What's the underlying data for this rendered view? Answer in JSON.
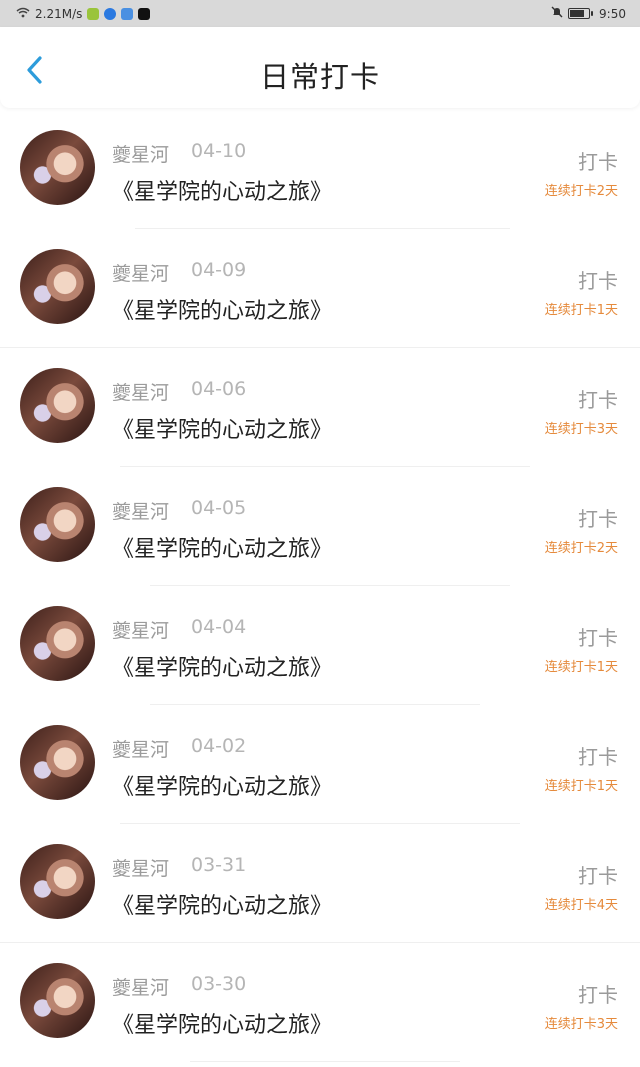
{
  "status_bar": {
    "speed": "2.21M/s",
    "time": "9:50"
  },
  "header": {
    "title": "日常打卡"
  },
  "items": [
    {
      "name": "夔星河",
      "date": "04-10",
      "book": "《星学院的心动之旅》",
      "action": "打卡",
      "streak": "连续打卡2天"
    },
    {
      "name": "夔星河",
      "date": "04-09",
      "book": "《星学院的心动之旅》",
      "action": "打卡",
      "streak": "连续打卡1天"
    },
    {
      "name": "夔星河",
      "date": "04-06",
      "book": "《星学院的心动之旅》",
      "action": "打卡",
      "streak": "连续打卡3天"
    },
    {
      "name": "夔星河",
      "date": "04-05",
      "book": "《星学院的心动之旅》",
      "action": "打卡",
      "streak": "连续打卡2天"
    },
    {
      "name": "夔星河",
      "date": "04-04",
      "book": "《星学院的心动之旅》",
      "action": "打卡",
      "streak": "连续打卡1天"
    },
    {
      "name": "夔星河",
      "date": "04-02",
      "book": "《星学院的心动之旅》",
      "action": "打卡",
      "streak": "连续打卡1天"
    },
    {
      "name": "夔星河",
      "date": "03-31",
      "book": "《星学院的心动之旅》",
      "action": "打卡",
      "streak": "连续打卡4天"
    },
    {
      "name": "夔星河",
      "date": "03-30",
      "book": "《星学院的心动之旅》",
      "action": "打卡",
      "streak": "连续打卡3天"
    }
  ],
  "colors": {
    "accent": "#2d9cdb",
    "streak": "#e58a3c"
  }
}
